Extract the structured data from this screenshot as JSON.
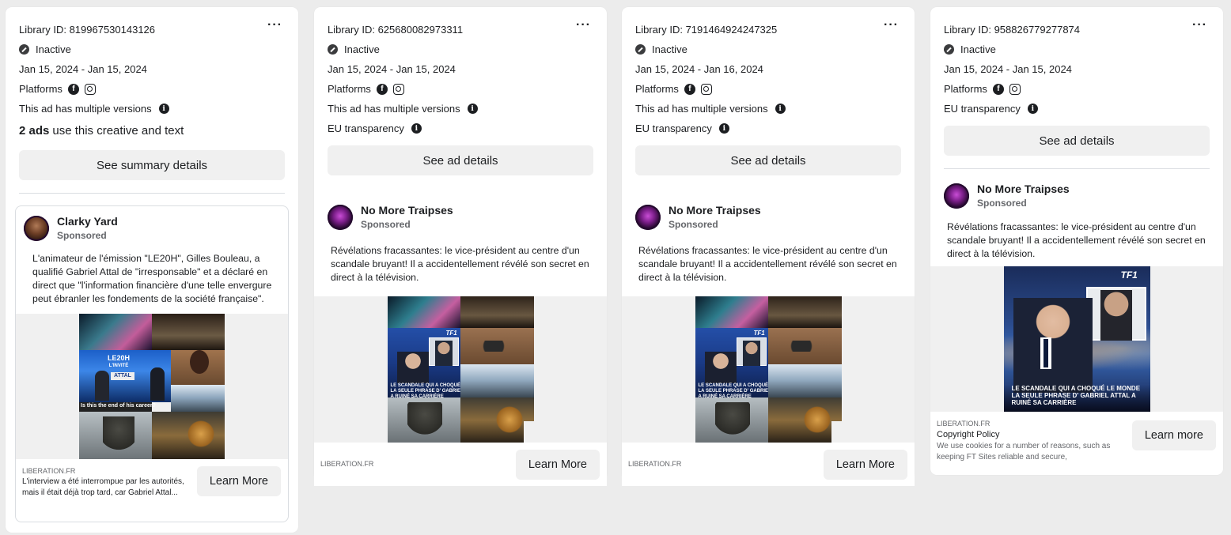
{
  "cards": [
    {
      "library_id": "Library ID: 819967530143126",
      "status": "Inactive",
      "dates": "Jan 15, 2024 - Jan 15, 2024",
      "platforms_label": "Platforms",
      "versions_label": "This ad has multiple versions",
      "ads_count": "2 ads",
      "ads_count_suffix": "use this creative and text",
      "button": "See summary details",
      "advertiser": "Clarky Yard",
      "sponsored": "Sponsored",
      "body": "L'animateur de l'émission \"LE20H\", Gilles Bouleau, a qualifié Gabriel Attal de \"irresponsable\" et a déclaré en direct que \"l'information financière d'une telle envergure peut ébranler les fondements de la société française\".",
      "image_caption": "Is this the end of his career?",
      "domain": "LIBERATION.FR",
      "link_desc": "L'interview a été interrompue par les autorités, mais il était déjà trop tard, car Gabriel Attal...",
      "cta": "Learn More"
    },
    {
      "library_id": "Library ID: 625680082973311",
      "status": "Inactive",
      "dates": "Jan 15, 2024 - Jan 15, 2024",
      "platforms_label": "Platforms",
      "versions_label": "This ad has multiple versions",
      "eu_label": "EU transparency",
      "button": "See ad details",
      "advertiser": "No More Traipses",
      "sponsored": "Sponsored",
      "body": "Révélations fracassantes: le vice-président au centre d'un scandale bruyant! Il a accidentellement révélé son secret en direct à la télévision.",
      "domain": "LIBERATION.FR",
      "cta": "Learn More"
    },
    {
      "library_id": "Library ID: 7191464924247325",
      "status": "Inactive",
      "dates": "Jan 15, 2024 - Jan 16, 2024",
      "platforms_label": "Platforms",
      "versions_label": "This ad has multiple versions",
      "eu_label": "EU transparency",
      "button": "See ad details",
      "advertiser": "No More Traipses",
      "sponsored": "Sponsored",
      "body": "Révélations fracassantes: le vice-président au centre d'un scandale bruyant! Il a accidentellement révélé son secret en direct à la télévision.",
      "domain": "LIBERATION.FR",
      "cta": "Learn More"
    },
    {
      "library_id": "Library ID: 958826779277874",
      "status": "Inactive",
      "dates": "Jan 15, 2024 - Jan 15, 2024",
      "platforms_label": "Platforms",
      "eu_label": "EU transparency",
      "button": "See ad details",
      "advertiser": "No More Traipses",
      "sponsored": "Sponsored",
      "body": "Révélations fracassantes: le vice-président au centre d'un scandale bruyant! Il a accidentellement révélé son secret en direct à la télévision.",
      "image_caption": "LE SCANDALE QUI A CHOQUÉ LE MONDE LA SEULE PHRASE D' GABRIEL ATTAL A RUINÉ SA CARRIÈRE",
      "tv_logo": "TF1",
      "domain": "LIBERATION.FR",
      "link_title": "Copyright Policy",
      "link_desc": "We use cookies for a number of reasons, such as keeping FT Sites reliable and secure, personalising...",
      "cta": "Learn more"
    }
  ],
  "icons": {
    "more": "ellipsis-icon",
    "status": "inactive-status-icon",
    "facebook": "facebook-icon",
    "instagram": "instagram-icon",
    "info": "info-icon"
  }
}
